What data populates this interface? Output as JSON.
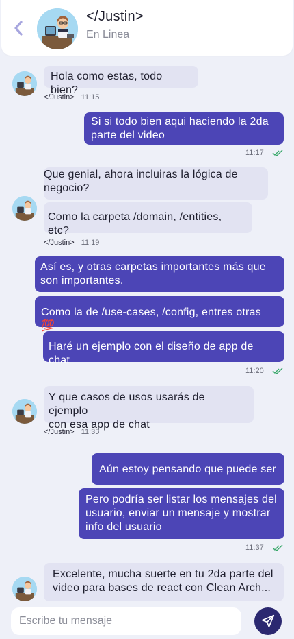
{
  "header": {
    "name": "</Justin>",
    "status": "En Linea"
  },
  "colors": {
    "background": "#eef0f8",
    "outgoing_bubble": "#4c45b6",
    "incoming_bubble": "#e2e3f2",
    "send_button": "#2b2870",
    "check_marks": "#3aa86b"
  },
  "messages": [
    {
      "dir": "in",
      "lines": [
        "Hola como estas, todo bien?"
      ]
    },
    {
      "dir": "out",
      "lines": [
        "Si si todo bien aqui haciendo la 2da",
        "parte del video"
      ]
    },
    {
      "dir": "in",
      "lines": [
        "Que genial, ahora incluiras la lógica de",
        "negocio?"
      ]
    },
    {
      "dir": "in",
      "lines": [
        "Como la carpeta /domain, /entities, etc?"
      ]
    },
    {
      "dir": "out",
      "lines": [
        "Así es, y otras carpetas importantes más que",
        "son importantes."
      ]
    },
    {
      "dir": "out",
      "lines": [
        "Como la de /use-cases, /config, entres otras 💯"
      ]
    },
    {
      "dir": "out",
      "lines": [
        "Haré un ejemplo con el diseño de app de chat"
      ]
    },
    {
      "dir": "in",
      "lines": [
        "Y que casos de usos usarás de ejemplo",
        "con esa app de chat"
      ]
    },
    {
      "dir": "out",
      "lines": [
        "Aún estoy pensando que puede ser"
      ]
    },
    {
      "dir": "out",
      "lines": [
        "Pero podría ser listar los mensajes del",
        "usuario, enviar un mensaje y mostrar",
        "info del usuario"
      ]
    },
    {
      "dir": "in",
      "lines": [
        "Excelente, mucha suerte en tu 2da parte del",
        "video para bases de react con Clean Arch..."
      ]
    }
  ],
  "meta": [
    {
      "who": "</Justin>",
      "time": "11:15"
    },
    {
      "time": "11:17",
      "icon": "double-check-icon"
    },
    {
      "who": "</Justin>",
      "time": "11:19"
    },
    {
      "time": "11:20",
      "icon": "double-check-icon"
    },
    {
      "who": "</Justin>",
      "time": "11:35"
    },
    {
      "time": "11:37",
      "icon": "double-check-icon"
    }
  ],
  "composer": {
    "placeholder": "Escribe tu mensaje",
    "send_icon": "send-icon"
  },
  "icons": {
    "back": "chevron-left-icon",
    "avatar": "avatar-cartoon-icon"
  }
}
